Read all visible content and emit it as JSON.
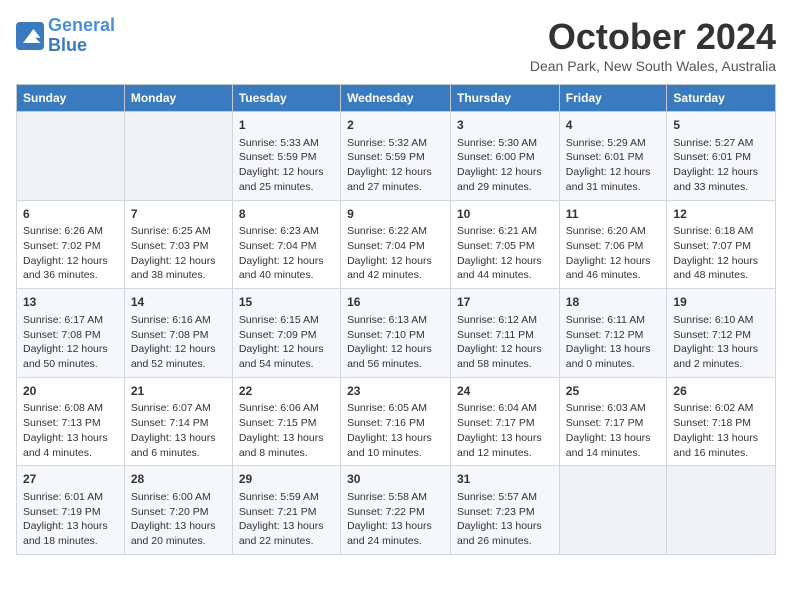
{
  "logo": {
    "general": "General",
    "blue": "Blue"
  },
  "title": "October 2024",
  "location": "Dean Park, New South Wales, Australia",
  "headers": [
    "Sunday",
    "Monday",
    "Tuesday",
    "Wednesday",
    "Thursday",
    "Friday",
    "Saturday"
  ],
  "weeks": [
    [
      {
        "day": "",
        "info": ""
      },
      {
        "day": "",
        "info": ""
      },
      {
        "day": "1",
        "info": "Sunrise: 5:33 AM\nSunset: 5:59 PM\nDaylight: 12 hours and 25 minutes."
      },
      {
        "day": "2",
        "info": "Sunrise: 5:32 AM\nSunset: 5:59 PM\nDaylight: 12 hours and 27 minutes."
      },
      {
        "day": "3",
        "info": "Sunrise: 5:30 AM\nSunset: 6:00 PM\nDaylight: 12 hours and 29 minutes."
      },
      {
        "day": "4",
        "info": "Sunrise: 5:29 AM\nSunset: 6:01 PM\nDaylight: 12 hours and 31 minutes."
      },
      {
        "day": "5",
        "info": "Sunrise: 5:27 AM\nSunset: 6:01 PM\nDaylight: 12 hours and 33 minutes."
      }
    ],
    [
      {
        "day": "6",
        "info": "Sunrise: 6:26 AM\nSunset: 7:02 PM\nDaylight: 12 hours and 36 minutes."
      },
      {
        "day": "7",
        "info": "Sunrise: 6:25 AM\nSunset: 7:03 PM\nDaylight: 12 hours and 38 minutes."
      },
      {
        "day": "8",
        "info": "Sunrise: 6:23 AM\nSunset: 7:04 PM\nDaylight: 12 hours and 40 minutes."
      },
      {
        "day": "9",
        "info": "Sunrise: 6:22 AM\nSunset: 7:04 PM\nDaylight: 12 hours and 42 minutes."
      },
      {
        "day": "10",
        "info": "Sunrise: 6:21 AM\nSunset: 7:05 PM\nDaylight: 12 hours and 44 minutes."
      },
      {
        "day": "11",
        "info": "Sunrise: 6:20 AM\nSunset: 7:06 PM\nDaylight: 12 hours and 46 minutes."
      },
      {
        "day": "12",
        "info": "Sunrise: 6:18 AM\nSunset: 7:07 PM\nDaylight: 12 hours and 48 minutes."
      }
    ],
    [
      {
        "day": "13",
        "info": "Sunrise: 6:17 AM\nSunset: 7:08 PM\nDaylight: 12 hours and 50 minutes."
      },
      {
        "day": "14",
        "info": "Sunrise: 6:16 AM\nSunset: 7:08 PM\nDaylight: 12 hours and 52 minutes."
      },
      {
        "day": "15",
        "info": "Sunrise: 6:15 AM\nSunset: 7:09 PM\nDaylight: 12 hours and 54 minutes."
      },
      {
        "day": "16",
        "info": "Sunrise: 6:13 AM\nSunset: 7:10 PM\nDaylight: 12 hours and 56 minutes."
      },
      {
        "day": "17",
        "info": "Sunrise: 6:12 AM\nSunset: 7:11 PM\nDaylight: 12 hours and 58 minutes."
      },
      {
        "day": "18",
        "info": "Sunrise: 6:11 AM\nSunset: 7:12 PM\nDaylight: 13 hours and 0 minutes."
      },
      {
        "day": "19",
        "info": "Sunrise: 6:10 AM\nSunset: 7:12 PM\nDaylight: 13 hours and 2 minutes."
      }
    ],
    [
      {
        "day": "20",
        "info": "Sunrise: 6:08 AM\nSunset: 7:13 PM\nDaylight: 13 hours and 4 minutes."
      },
      {
        "day": "21",
        "info": "Sunrise: 6:07 AM\nSunset: 7:14 PM\nDaylight: 13 hours and 6 minutes."
      },
      {
        "day": "22",
        "info": "Sunrise: 6:06 AM\nSunset: 7:15 PM\nDaylight: 13 hours and 8 minutes."
      },
      {
        "day": "23",
        "info": "Sunrise: 6:05 AM\nSunset: 7:16 PM\nDaylight: 13 hours and 10 minutes."
      },
      {
        "day": "24",
        "info": "Sunrise: 6:04 AM\nSunset: 7:17 PM\nDaylight: 13 hours and 12 minutes."
      },
      {
        "day": "25",
        "info": "Sunrise: 6:03 AM\nSunset: 7:17 PM\nDaylight: 13 hours and 14 minutes."
      },
      {
        "day": "26",
        "info": "Sunrise: 6:02 AM\nSunset: 7:18 PM\nDaylight: 13 hours and 16 minutes."
      }
    ],
    [
      {
        "day": "27",
        "info": "Sunrise: 6:01 AM\nSunset: 7:19 PM\nDaylight: 13 hours and 18 minutes."
      },
      {
        "day": "28",
        "info": "Sunrise: 6:00 AM\nSunset: 7:20 PM\nDaylight: 13 hours and 20 minutes."
      },
      {
        "day": "29",
        "info": "Sunrise: 5:59 AM\nSunset: 7:21 PM\nDaylight: 13 hours and 22 minutes."
      },
      {
        "day": "30",
        "info": "Sunrise: 5:58 AM\nSunset: 7:22 PM\nDaylight: 13 hours and 24 minutes."
      },
      {
        "day": "31",
        "info": "Sunrise: 5:57 AM\nSunset: 7:23 PM\nDaylight: 13 hours and 26 minutes."
      },
      {
        "day": "",
        "info": ""
      },
      {
        "day": "",
        "info": ""
      }
    ]
  ]
}
